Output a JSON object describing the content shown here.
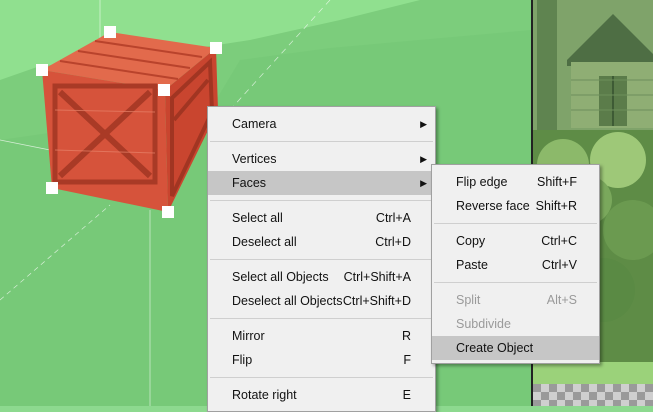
{
  "main_menu": {
    "groups": [
      [
        {
          "label": "Camera",
          "submenu": true
        }
      ],
      [
        {
          "label": "Vertices",
          "submenu": true
        },
        {
          "label": "Faces",
          "submenu": true,
          "highlighted": true
        }
      ],
      [
        {
          "label": "Select all",
          "shortcut": "Ctrl+A"
        },
        {
          "label": "Deselect all",
          "shortcut": "Ctrl+D"
        }
      ],
      [
        {
          "label": "Select all Objects",
          "shortcut": "Ctrl+Shift+A"
        },
        {
          "label": "Deselect all Objects",
          "shortcut": "Ctrl+Shift+D"
        }
      ],
      [
        {
          "label": "Mirror",
          "shortcut": "R"
        },
        {
          "label": "Flip",
          "shortcut": "F"
        }
      ],
      [
        {
          "label": "Rotate right",
          "shortcut": "E"
        }
      ]
    ]
  },
  "faces_submenu": {
    "groups": [
      [
        {
          "label": "Flip edge",
          "shortcut": "Shift+F"
        },
        {
          "label": "Reverse face",
          "shortcut": "Shift+R"
        }
      ],
      [
        {
          "label": "Copy",
          "shortcut": "Ctrl+C"
        },
        {
          "label": "Paste",
          "shortcut": "Ctrl+V"
        }
      ],
      [
        {
          "label": "Split",
          "shortcut": "Alt+S",
          "disabled": true
        },
        {
          "label": "Subdivide",
          "disabled": true
        },
        {
          "label": "Create Object",
          "highlighted": true
        }
      ]
    ]
  },
  "colors": {
    "viewport_bg": "#90e08f",
    "ground": "#7cce7d",
    "crate": "#d9503c",
    "menu_bg": "#f0f0f0",
    "highlight": "#c6c6c6"
  }
}
